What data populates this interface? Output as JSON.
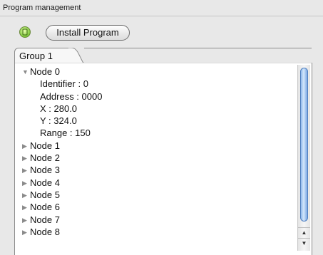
{
  "panel": {
    "title": "Program management"
  },
  "toolbar": {
    "status_icon": "green-status-icon",
    "install_label": "Install Program"
  },
  "tabs": [
    {
      "label": "Group 1",
      "selected": true
    }
  ],
  "tree": {
    "expanded_node": {
      "label": "Node 0",
      "details": [
        "Identifier : 0",
        "Address : 0000",
        "X : 280.0",
        "Y : 324.0",
        "Range : 150"
      ]
    },
    "collapsed_nodes": [
      "Node 1",
      "Node 2",
      "Node 3",
      "Node 4",
      "Node 5",
      "Node 6",
      "Node 7",
      "Node 8"
    ]
  },
  "colors": {
    "status_green": "#4caf2a",
    "scroll_thumb": "#8fb8ec"
  }
}
